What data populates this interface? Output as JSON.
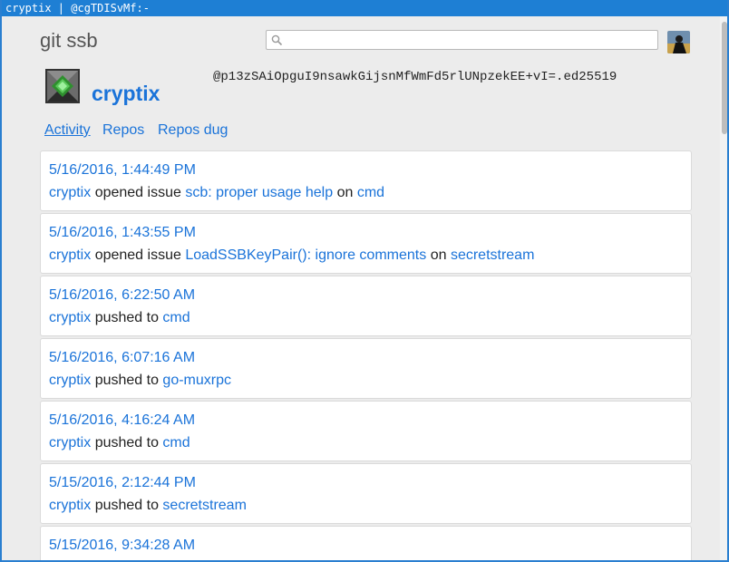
{
  "window": {
    "title": "cryptix | @cgTDISvMf:-"
  },
  "header": {
    "site_title": "git ssb",
    "search": {
      "value": "",
      "placeholder": ""
    }
  },
  "profile": {
    "name": "cryptix",
    "feed_id": "@p13zSAiOpguI9nsawkGijsnMfWmFd5rlUNpzekEE+vI=.ed25519"
  },
  "tabs": [
    {
      "label": "Activity",
      "active": true
    },
    {
      "label": "Repos",
      "active": false
    },
    {
      "label": "Repos dug",
      "active": false
    }
  ],
  "activity": [
    {
      "time": "5/16/2016, 1:44:49 PM",
      "actor": "cryptix",
      "verb": "opened issue",
      "object": "scb: proper usage help",
      "prep": "on",
      "repo": "cmd"
    },
    {
      "time": "5/16/2016, 1:43:55 PM",
      "actor": "cryptix",
      "verb": "opened issue",
      "object": "LoadSSBKeyPair(): ignore comments",
      "prep": "on",
      "repo": "secretstream"
    },
    {
      "time": "5/16/2016, 6:22:50 AM",
      "actor": "cryptix",
      "verb": "pushed to",
      "object": "",
      "prep": "",
      "repo": "cmd"
    },
    {
      "time": "5/16/2016, 6:07:16 AM",
      "actor": "cryptix",
      "verb": "pushed to",
      "object": "",
      "prep": "",
      "repo": "go-muxrpc"
    },
    {
      "time": "5/16/2016, 4:16:24 AM",
      "actor": "cryptix",
      "verb": "pushed to",
      "object": "",
      "prep": "",
      "repo": "cmd"
    },
    {
      "time": "5/15/2016, 2:12:44 PM",
      "actor": "cryptix",
      "verb": "pushed to",
      "object": "",
      "prep": "",
      "repo": "secretstream"
    },
    {
      "time": "5/15/2016, 9:34:28 AM",
      "actor": "",
      "verb": "",
      "object": "",
      "prep": "",
      "repo": ""
    }
  ],
  "icons": {
    "search": "search-icon",
    "user_avatar": "user-avatar-icon",
    "profile_avatar": "profile-avatar-icon"
  },
  "colors": {
    "link": "#1a73d9",
    "titlebar": "#1e7fd4",
    "background": "#ececec"
  }
}
